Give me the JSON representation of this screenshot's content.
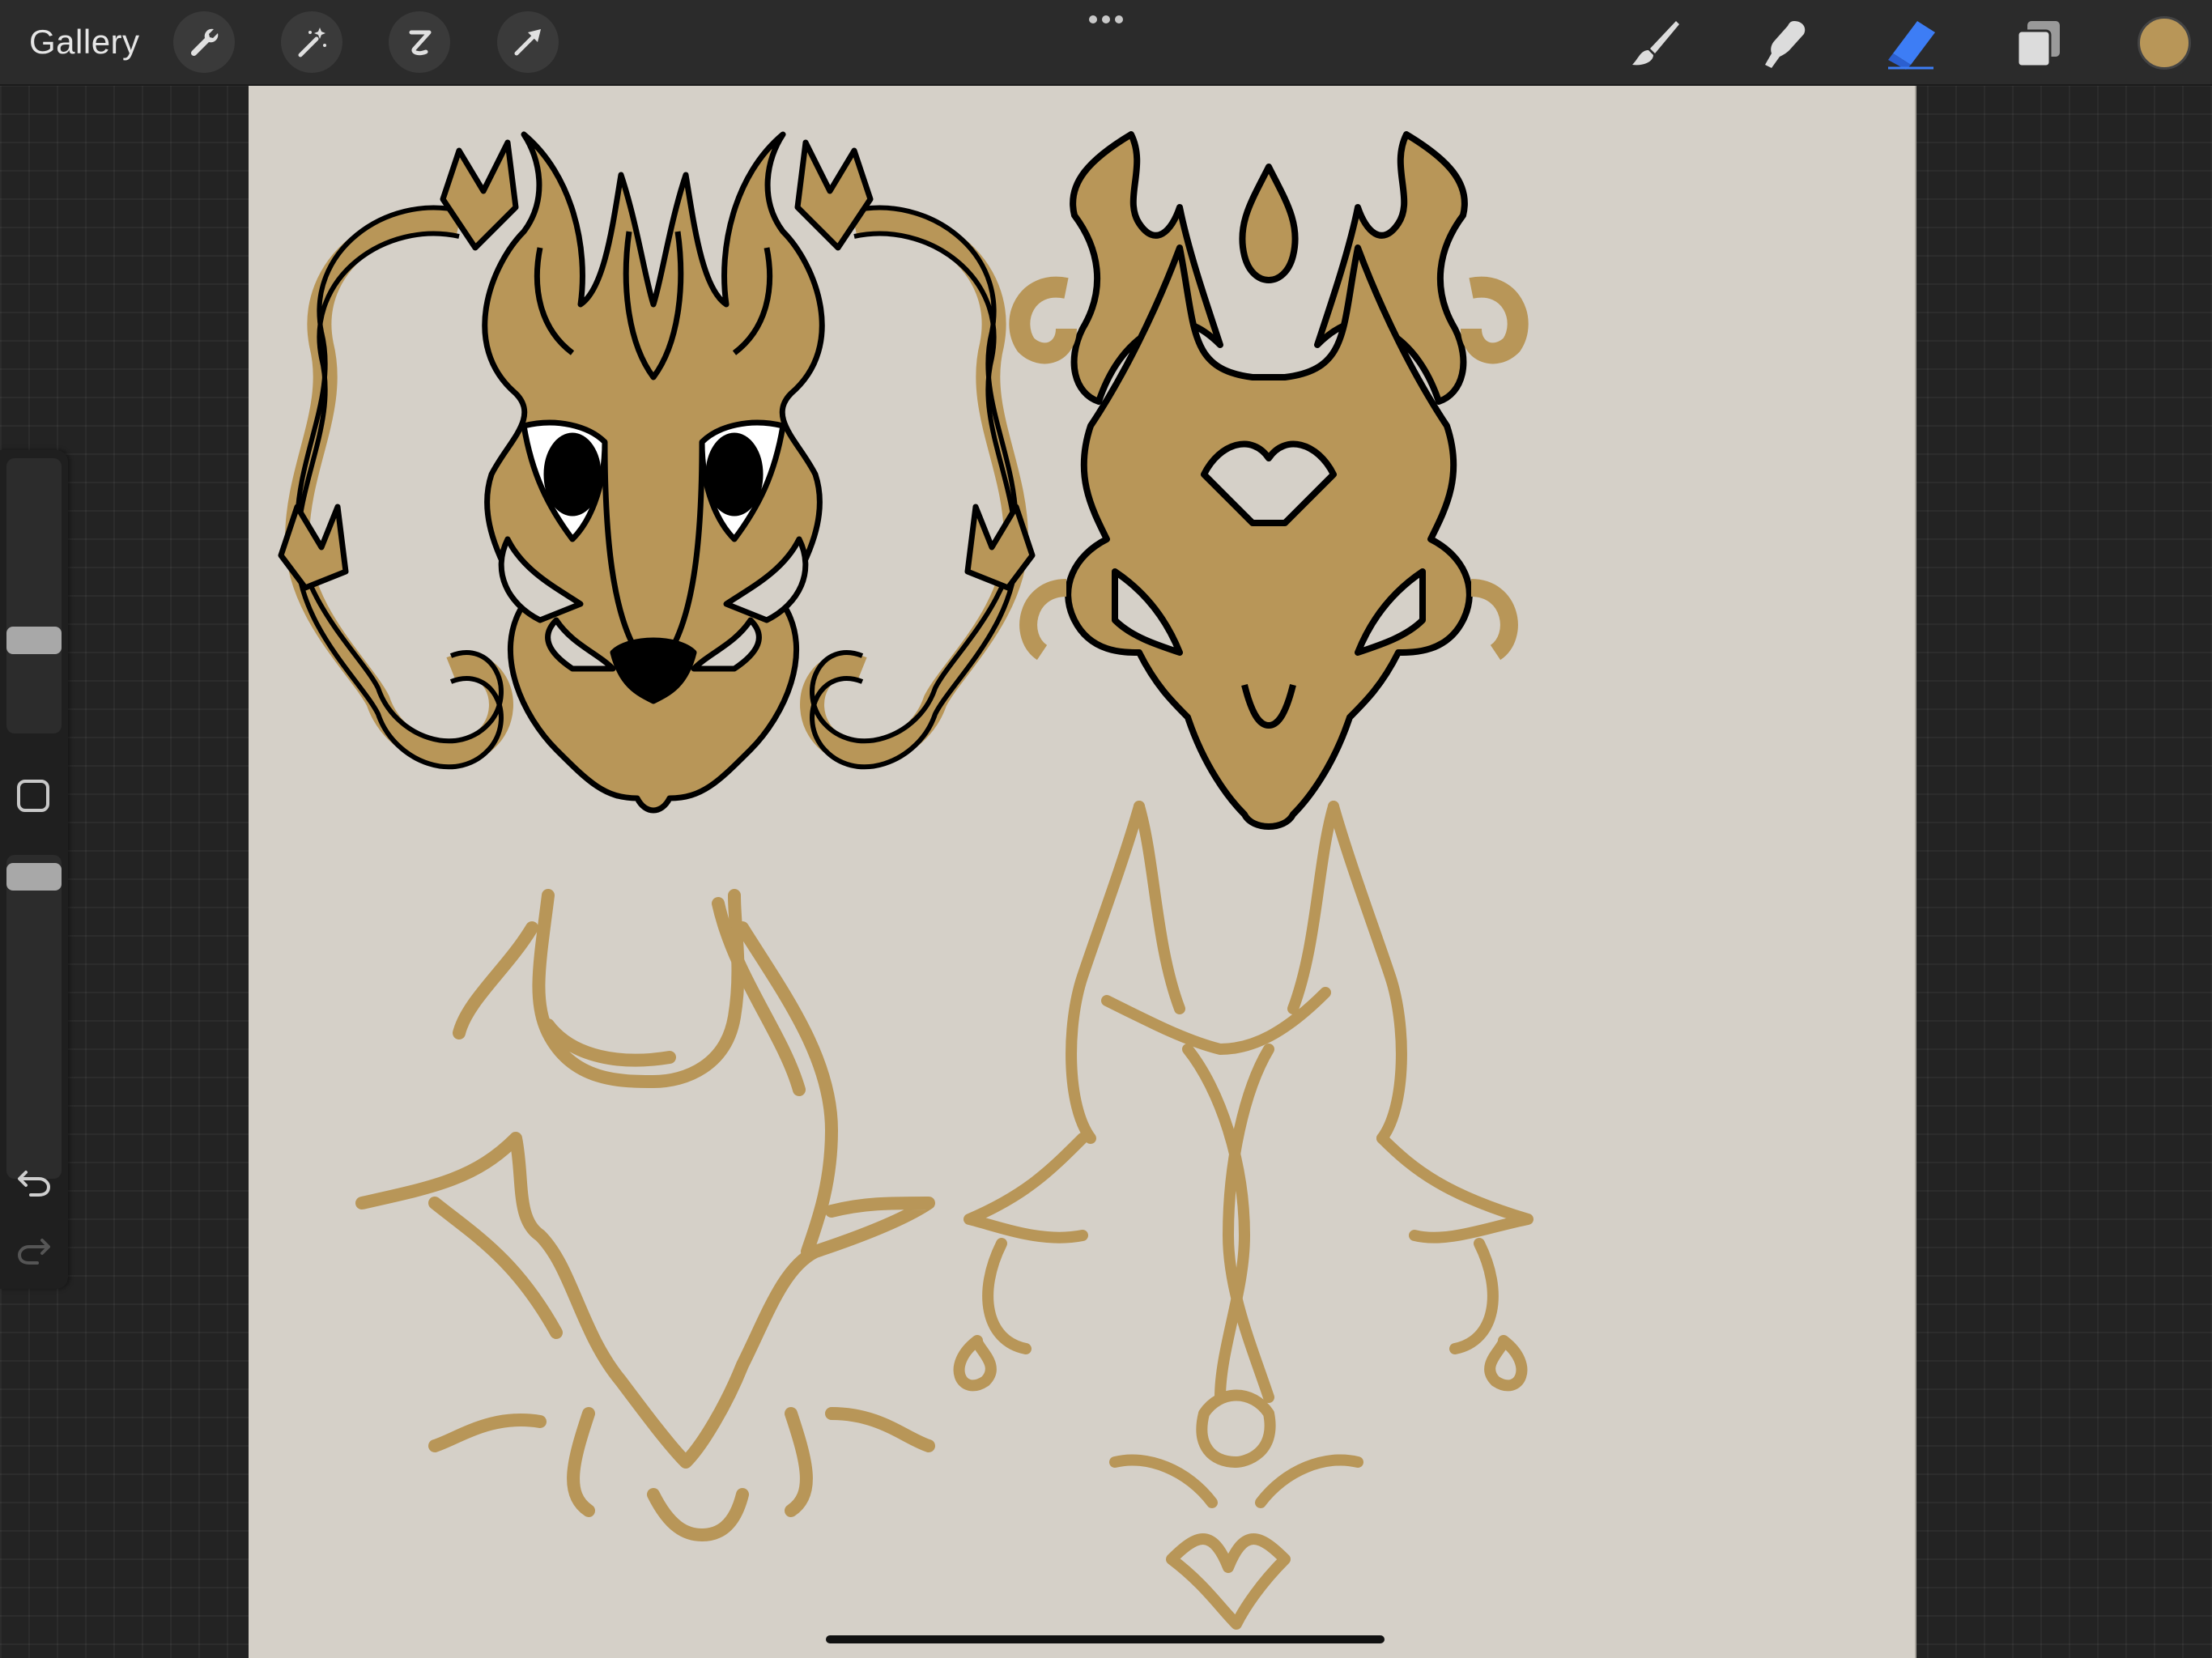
{
  "toolbar": {
    "gallery_label": "Gallery",
    "left_tools": [
      "wrench-icon",
      "magic-wand-icon",
      "selection-icon",
      "transform-arrow-icon"
    ],
    "right_tools": [
      "brush-icon",
      "smudge-icon",
      "eraser-icon",
      "layers-icon"
    ],
    "active_tool": "eraser",
    "active_tool_color": "#3d7df5",
    "current_color": "#b89658"
  },
  "sidebar": {
    "brush_size_level": 0.65,
    "opacity_level": 0.97,
    "modify_button": "square-modify-icon",
    "undo_icon": "undo-icon",
    "redo_icon": "redo-icon"
  },
  "canvas": {
    "background_color": "#d5d0c8",
    "ink_color": "#b89658",
    "outline_color": "#000000"
  }
}
